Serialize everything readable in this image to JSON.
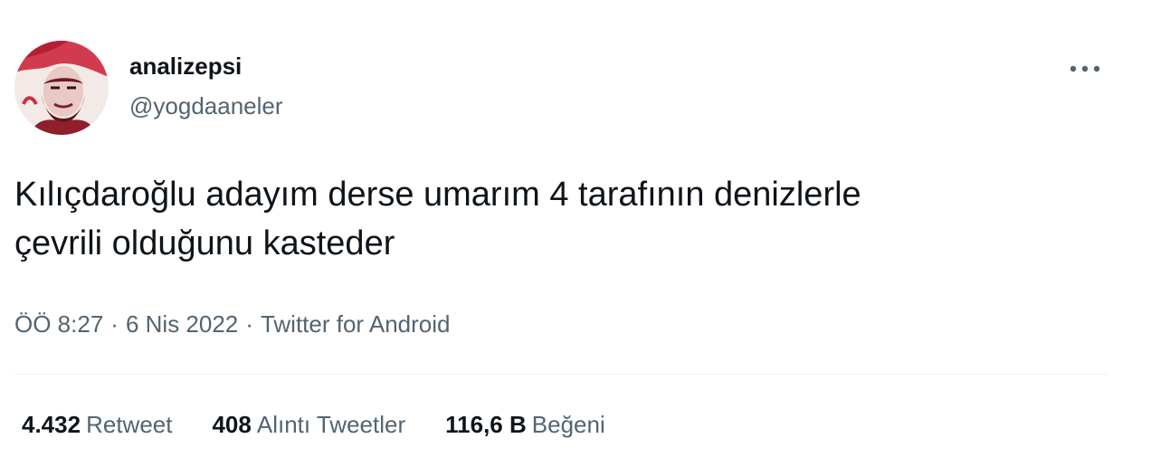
{
  "user": {
    "display_name": "analizepsi",
    "handle": "@yogdaaneler",
    "avatar": "profile-photo"
  },
  "more_icon": "more-horizontal-icon",
  "tweet": {
    "text": "Kılıçdaroğlu adayım derse umarım 4 tarafının denizlerle\nçevrili olduğunu kasteder"
  },
  "meta": {
    "time": "ÖÖ 8:27",
    "separator": "·",
    "date": "6 Nis 2022",
    "source": "Twitter for Android"
  },
  "stats": {
    "retweets_count": "4.432",
    "retweets_label": "Retweet",
    "quotes_count": "408",
    "quotes_label": "Alıntı Tweetler",
    "likes_count": "116,6 B",
    "likes_label": "Beğeni"
  },
  "colors": {
    "text_primary": "#0f1419",
    "text_secondary": "#536471",
    "divider": "#eff3f4"
  }
}
